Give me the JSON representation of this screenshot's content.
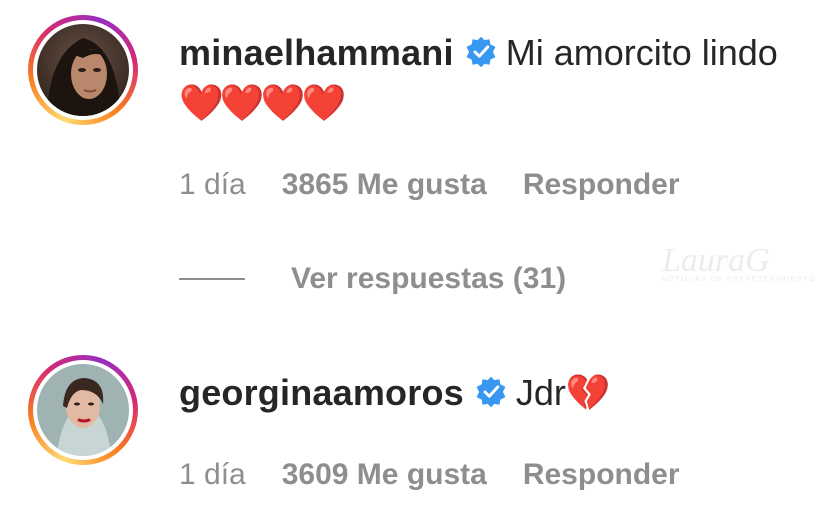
{
  "comments": [
    {
      "username": "minaelhammani",
      "text": "Mi amorcito lindo",
      "emoji": "❤️❤️❤️❤️",
      "time": "1 día",
      "likes": "3865 Me gusta",
      "reply_label": "Responder",
      "view_replies": "Ver respuestas (31)"
    },
    {
      "username": "georginaamoros",
      "text": "Jdr",
      "emoji": "💔",
      "time": "1 día",
      "likes": "3609 Me gusta",
      "reply_label": "Responder"
    }
  ],
  "watermark": {
    "brand": "LauraG",
    "tagline": "NOTICIAS DE ENTRETENIMIENTO"
  },
  "colors": {
    "text": "#262626",
    "muted": "#8e8e8e",
    "verified": "#3897f0",
    "heart": "#e0112b"
  }
}
